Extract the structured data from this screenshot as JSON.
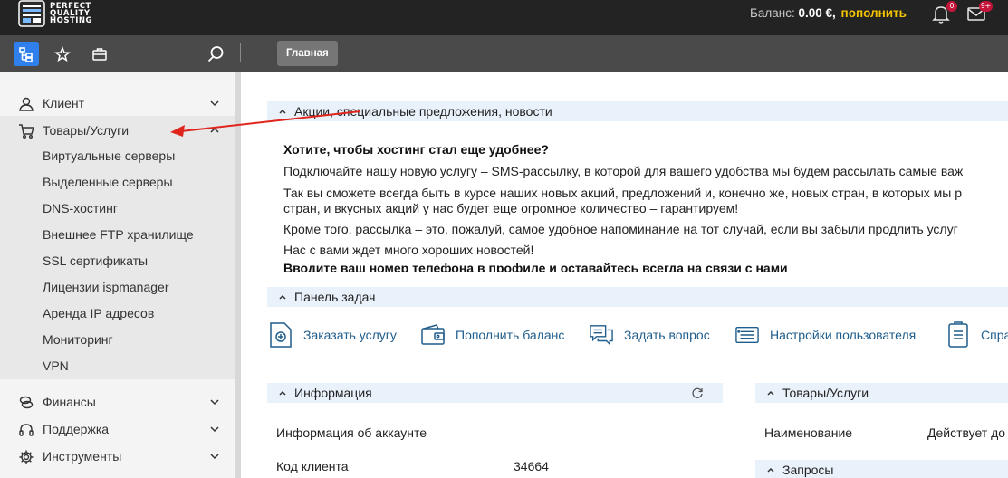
{
  "brand": {
    "logo_line1": "PERFECT",
    "logo_line2": "QUALITY",
    "logo_line3": "HOSTING"
  },
  "header": {
    "balance_label": "Баланс:",
    "balance_amount": "0.00 €,",
    "topup_link": "пополнить",
    "notifications_count": "0",
    "messages_count": "9+"
  },
  "toolbar": {
    "active_tab": "Главная"
  },
  "sidebar": {
    "client": "Клиент",
    "products": "Товары/Услуги",
    "sub_items": [
      "Виртуальные серверы",
      "Выделенные серверы",
      "DNS-хостинг",
      "Внешнее FTP хранилище",
      "SSL сертификаты",
      "Лицензии ispmanager",
      "Аренда IP адресов",
      "Мониторинг",
      "VPN"
    ],
    "finance": "Финансы",
    "support": "Поддержка",
    "tools": "Инструменты"
  },
  "news": {
    "header": "Акции, специальные предложения, новости",
    "title": "Хотите, чтобы хостинг стал еще удобнее?",
    "p1": "Подключайте нашу новую услугу – SMS-рассылку, в которой для вашего удобства мы будем рассылать самые важ",
    "p2a": "Так вы сможете всегда быть в курсе наших новых акций, предложений и, конечно же, новых стран, в которых мы р",
    "p2b": "стран, и вкусных акций у нас будет еще огромное количество – гарантируем!",
    "p3": "Кроме того, рассылка – это, пожалуй, самое удобное напоминание на тот случай, если вы забыли продлить услуг",
    "p4": "Нас с вами ждет много хороших новостей!",
    "p5": "Вводите ваш номер телефона в профиле и оставайтесь всегда на связи с нами"
  },
  "tasks": {
    "header": "Панель задач",
    "order": "Заказать услугу",
    "topup": "Пополнить баланс",
    "ask": "Задать вопрос",
    "settings": "Настройки пользователя",
    "help": "Спра"
  },
  "info": {
    "header": "Информация",
    "account_info": "Информация об аккаунте",
    "client_code_label": "Код клиента",
    "client_code_value": "34664"
  },
  "products_panel": {
    "header": "Товары/Услуги",
    "col_name": "Наименование",
    "col_valid": "Действует до"
  },
  "requests_panel": {
    "header": "Запросы"
  },
  "colors": {
    "topbar": "#232323",
    "toolbar": "#4a4a4a",
    "accent_blue": "#2f80ed",
    "topup_yellow": "#f5c400",
    "badge_red": "#c4153a",
    "section_header": "#e9f1fb",
    "annotation_arrow": "#e0261c"
  }
}
